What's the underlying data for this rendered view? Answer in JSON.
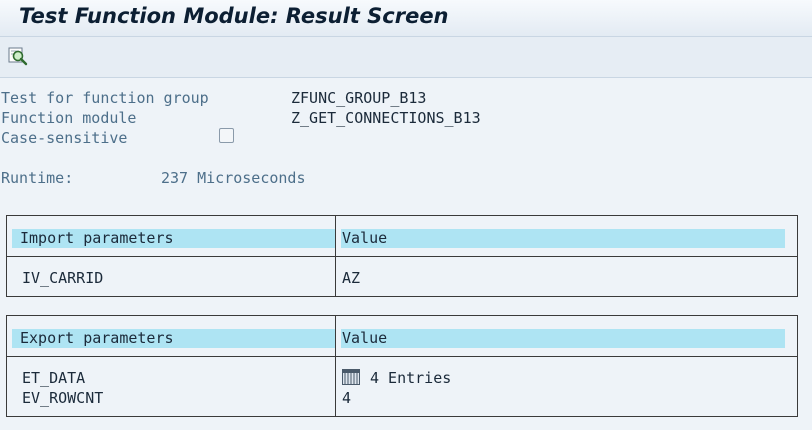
{
  "window": {
    "title": "Test Function Module: Result Screen"
  },
  "toolbar": {
    "buttons": [
      {
        "icon": "magnifier-icon"
      }
    ]
  },
  "info": {
    "function_group_label": "Test for function group",
    "function_group_value": "ZFUNC_GROUP_B13",
    "function_module_label": "Function module",
    "function_module_value": "Z_GET_CONNECTIONS_B13",
    "case_sensitive_label": "Case-sensitive",
    "case_sensitive_checked": false,
    "runtime_label": "Runtime:",
    "runtime_value": "237 Microseconds"
  },
  "import": {
    "header_param": "Import parameters",
    "header_value": "Value",
    "rows": [
      {
        "name": "IV_CARRID",
        "value": "AZ"
      }
    ]
  },
  "export": {
    "header_param": "Export parameters",
    "header_value": "Value",
    "rows": [
      {
        "name": "ET_DATA",
        "value": "4 Entries",
        "icon": "table-icon"
      },
      {
        "name": "EV_ROWCNT",
        "value": "4"
      }
    ]
  },
  "colors": {
    "header_fill": "#aee4f3",
    "background": "#eef3f8",
    "label": "#4d6f8a"
  }
}
